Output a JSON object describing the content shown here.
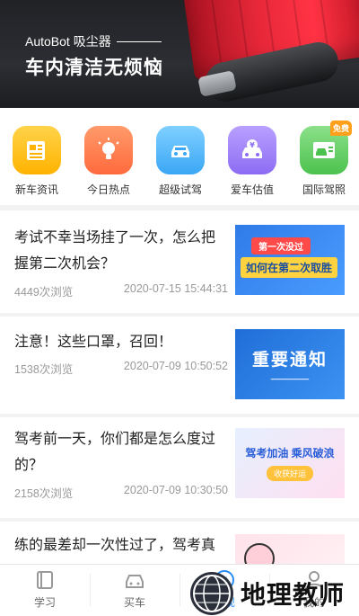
{
  "banner": {
    "brand": "AutoBot 吸尘器",
    "slogan": "车内清洁无烦恼"
  },
  "categories": [
    {
      "label": "新车资讯",
      "icon": "news-document-icon",
      "color": "#ffb300"
    },
    {
      "label": "今日热点",
      "icon": "lightbulb-icon",
      "color": "#ff6a3d"
    },
    {
      "label": "超级试驾",
      "icon": "car-icon",
      "color": "#3aa6f5"
    },
    {
      "label": "爱车估值",
      "icon": "car-yen-icon",
      "color": "#8d6cf3"
    },
    {
      "label": "国际驾照",
      "icon": "license-card-icon",
      "color": "#4cc24e",
      "badge": "免费"
    }
  ],
  "news": [
    {
      "title": "考试不幸当场挂了一次，怎么把握第二次机会？",
      "views": "4449次浏览",
      "date": "2020-07-15 15:44:31",
      "thumb_ribbon": "第一次没过",
      "thumb_headline": "如何在第二次取胜"
    },
    {
      "title": "注意！这些口罩，召回！",
      "views": "1538次浏览",
      "date": "2020-07-09 10:50:52",
      "thumb_headline": "重要通知"
    },
    {
      "title": "驾考前一天，你们都是怎么度过的？",
      "views": "2158次浏览",
      "date": "2020-07-09 10:30:50",
      "thumb_headline": "驾考加油 乘风破浪",
      "thumb_button": "收获好运"
    },
    {
      "title": "练的最差却一次性过了，驾考真",
      "views": "",
      "date": ""
    }
  ],
  "bottom_nav": [
    {
      "label": "学习",
      "icon": "book-icon"
    },
    {
      "label": "买车",
      "icon": "car-outline-icon"
    },
    {
      "label": "发现",
      "icon": "compass-icon",
      "active": true
    },
    {
      "label": "我的",
      "icon": "person-icon"
    }
  ],
  "watermark": {
    "text": "地理教师"
  }
}
